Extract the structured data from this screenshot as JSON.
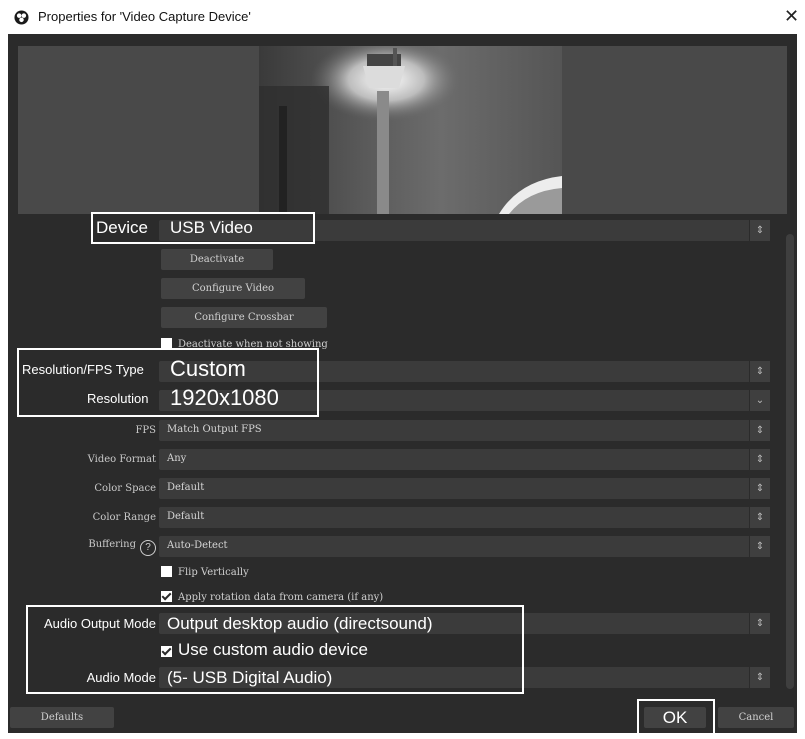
{
  "title": "Properties for 'Video Capture Device'",
  "labels": {
    "device": "Device",
    "res_fps_type": "Resolution/FPS Type",
    "resolution": "Resolution",
    "fps": "FPS",
    "video_format": "Video Format",
    "color_space": "Color Space",
    "color_range": "Color Range",
    "buffering": "Buffering",
    "audio_output_mode": "Audio Output Mode",
    "audio_mode": "Audio Mode"
  },
  "values": {
    "device": "USB Video",
    "res_fps_type": "Custom",
    "resolution": "1920x1080",
    "fps": "Match Output FPS",
    "video_format": "Any",
    "color_space": "Default",
    "color_range": "Default",
    "buffering": "Auto-Detect",
    "audio_output_mode": "Output desktop audio (directsound)",
    "audio_mode": "(5- USB Digital Audio)"
  },
  "buttons": {
    "deactivate": "Deactivate",
    "configure_video": "Configure Video",
    "configure_crossbar": "Configure Crossbar",
    "defaults": "Defaults",
    "ok": "OK",
    "cancel": "Cancel"
  },
  "checks": {
    "deactivate_not_showing": {
      "label": "Deactivate when not showing",
      "checked": false
    },
    "flip_vertically": {
      "label": "Flip Vertically",
      "checked": false
    },
    "apply_rotation": {
      "label": "Apply rotation data from camera (if any)",
      "checked": true
    },
    "use_custom_audio": {
      "label": "Use custom audio device",
      "checked": true
    }
  },
  "icons": {
    "app": "obs-logo-icon",
    "close": "close-icon",
    "spin": "updown-spinner-icon",
    "dropdown": "chevron-down-icon",
    "help": "help-icon"
  },
  "colors": {
    "window_bg": "#2b2b2b",
    "field_bg": "#3b3b3b",
    "highlight": "#ffffff"
  }
}
